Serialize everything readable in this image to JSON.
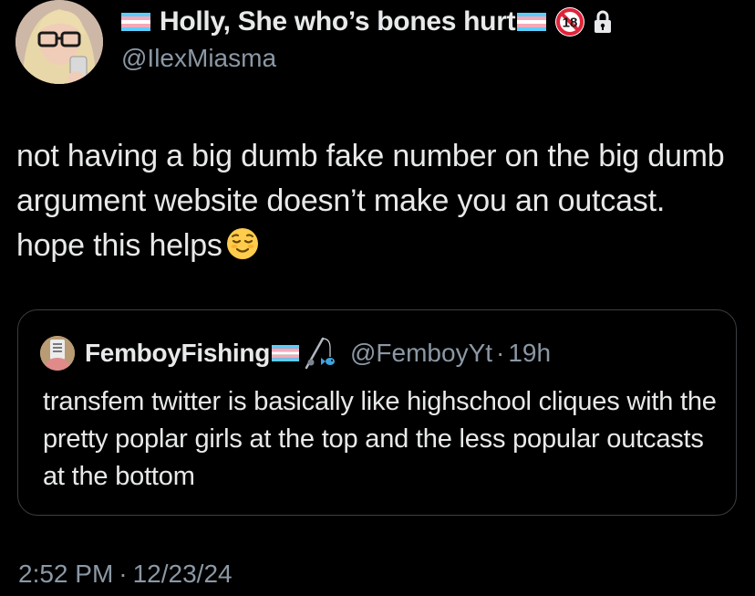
{
  "author": {
    "name": "Holly, She who’s bones hurt",
    "handle": "@IlexMiasma"
  },
  "icons": {
    "flag": "transgender-flag-icon",
    "age_badge": "no-under-18-icon",
    "lock": "lock-icon",
    "emoji": "relieved-face-emoji",
    "rod": "fishing-rod-icon"
  },
  "colors": {
    "background": "#000000",
    "text_primary": "#e7e9ea",
    "text_secondary": "#8b98a5",
    "border": "#3a3f44",
    "flag_blue": "#5bcefa",
    "flag_pink": "#f5a9b8",
    "flag_white": "#ffffff",
    "badge_red": "#e0243a"
  },
  "tweet": {
    "text": "not having a big dumb fake number on the big dumb argument website doesn’t make you an outcast. hope this helps"
  },
  "quote": {
    "name": "FemboyFishing",
    "handle": "@FemboyYt",
    "separator": "·",
    "time": "19h",
    "text": "transfem twitter is basically like highschool cliques with the pretty poplar girls at the top and the less popular outcasts at the bottom"
  },
  "timestamp": {
    "time": "2:52 PM",
    "separator": "·",
    "date": "12/23/24"
  }
}
